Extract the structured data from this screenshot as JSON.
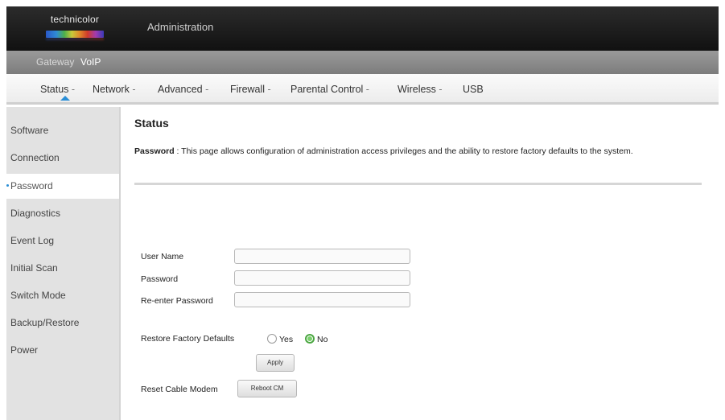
{
  "header": {
    "logo_text": "technicolor",
    "title": "Administration"
  },
  "primary_nav": {
    "items": [
      {
        "label": "Gateway"
      },
      {
        "label": "VoIP"
      }
    ]
  },
  "secondary_nav": {
    "items": [
      {
        "label": "Status",
        "sep": " -"
      },
      {
        "label": "Network",
        "sep": " -"
      },
      {
        "label": "Advanced",
        "sep": " -"
      },
      {
        "label": "Firewall",
        "sep": " -"
      },
      {
        "label": "Parental Control",
        "sep": " -"
      },
      {
        "label": "Wireless",
        "sep": " -"
      },
      {
        "label": "USB",
        "sep": ""
      }
    ],
    "active": "Status"
  },
  "sidebar": {
    "items": [
      {
        "label": "Software"
      },
      {
        "label": "Connection"
      },
      {
        "label": "Password"
      },
      {
        "label": "Diagnostics"
      },
      {
        "label": "Event Log"
      },
      {
        "label": "Initial Scan"
      },
      {
        "label": "Switch Mode"
      },
      {
        "label": "Backup/Restore"
      },
      {
        "label": "Power"
      }
    ],
    "active": "Password"
  },
  "main": {
    "title": "Status",
    "desc_label": "Password",
    "desc_sep": " : ",
    "desc_text": " This page allows configuration of administration access privileges and the ability to restore factory defaults to the system."
  },
  "form": {
    "username_label": "User Name",
    "username_value": "",
    "password_label": "Password",
    "password_value": "",
    "reenter_label": "Re-enter Password",
    "reenter_value": "",
    "restore_label": "Restore Factory Defaults",
    "restore_yes": "Yes",
    "restore_no": "No",
    "restore_selected": "No",
    "apply_label": "Apply",
    "reset_label": "Reset Cable Modem",
    "reboot_label": "Reboot CM"
  },
  "colors": {
    "accent": "#2a8ed6",
    "radio_checked": "#4aa640"
  }
}
